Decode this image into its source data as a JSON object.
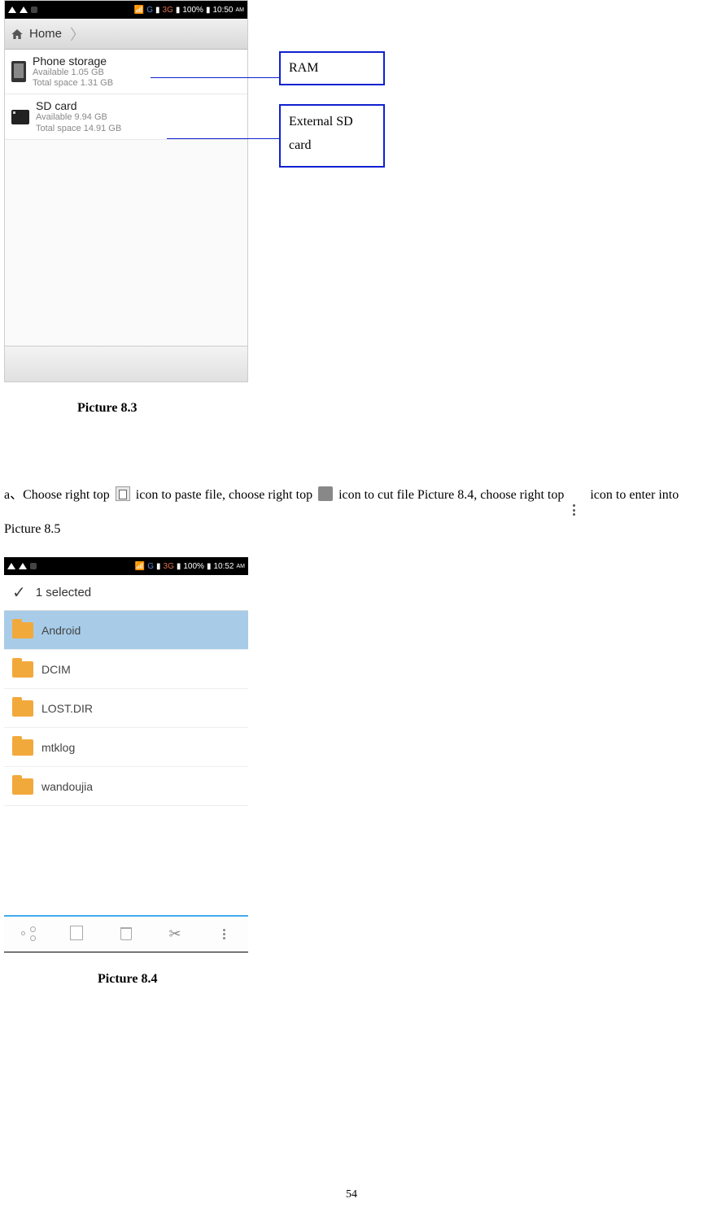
{
  "page_number": "54",
  "screenshot1": {
    "statusbar": {
      "battery": "100%",
      "time": "10:50",
      "ampm": "AM",
      "net_g": "G",
      "net_3g": "3G",
      "signal_bars": "▮"
    },
    "home_label": "Home",
    "items": [
      {
        "title": "Phone storage",
        "line1": "Available 1.05 GB",
        "line2": "Total space 1.31 GB"
      },
      {
        "title": "SD card",
        "line1": "Available 9.94 GB",
        "line2": "Total space 14.91 GB"
      }
    ]
  },
  "annotations": {
    "ram": "RAM",
    "sd": "External SD card"
  },
  "captions": {
    "c1": "Picture 8.3",
    "c2": "Picture 8.4"
  },
  "paragraph": {
    "p1": "a、Choose right top ",
    "p2": " icon to paste file, choose right top ",
    "p3": " icon to cut file Picture 8.4, choose right top ",
    "p4": " icon to enter into Picture 8.5"
  },
  "screenshot2": {
    "statusbar": {
      "battery": "100%",
      "time": "10:52",
      "ampm": "AM",
      "net_g": "G",
      "net_3g": "3G"
    },
    "selected_label": "1 selected",
    "folders": [
      {
        "name": "Android",
        "selected": true
      },
      {
        "name": "DCIM",
        "selected": false
      },
      {
        "name": "LOST.DIR",
        "selected": false
      },
      {
        "name": "mtklog",
        "selected": false
      },
      {
        "name": "wandoujia",
        "selected": false
      }
    ]
  }
}
